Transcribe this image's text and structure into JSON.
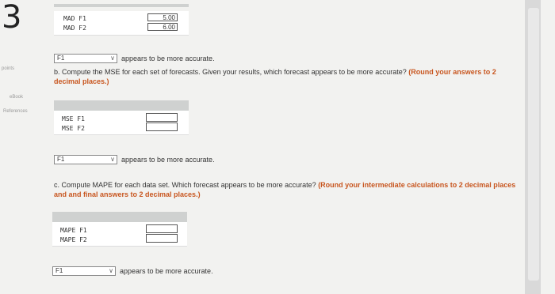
{
  "question_number": "3",
  "sidebar": {
    "points": "points",
    "ebook": "eBook",
    "references": "References"
  },
  "section_a": {
    "rows": [
      {
        "label": "MAD F1",
        "value": "5.00"
      },
      {
        "label": "MAD F2",
        "value": "6.00"
      }
    ],
    "select_value": "F1",
    "after_text": "appears to be more accurate."
  },
  "section_b": {
    "question": "b. Compute the MSE for each set of forecasts. Given your results, which forecast appears to be more accurate?",
    "emphasis": "(Round your answers to 2 decimal places.)",
    "rows": [
      {
        "label": "MSE F1",
        "value": ""
      },
      {
        "label": "MSE F2",
        "value": ""
      }
    ],
    "select_value": "F1",
    "after_text": "appears to be more accurate."
  },
  "section_c": {
    "question": "c. Compute MAPE for each data set. Which forecast appears to be more accurate?",
    "emphasis": "(Round your intermediate calculations to 2 decimal places and and final answers to 2 decimal places.)",
    "rows": [
      {
        "label": "MAPE F1",
        "value": ""
      },
      {
        "label": "MAPE F2",
        "value": ""
      }
    ],
    "select_value": "F1",
    "after_text": "appears to be more accurate."
  }
}
